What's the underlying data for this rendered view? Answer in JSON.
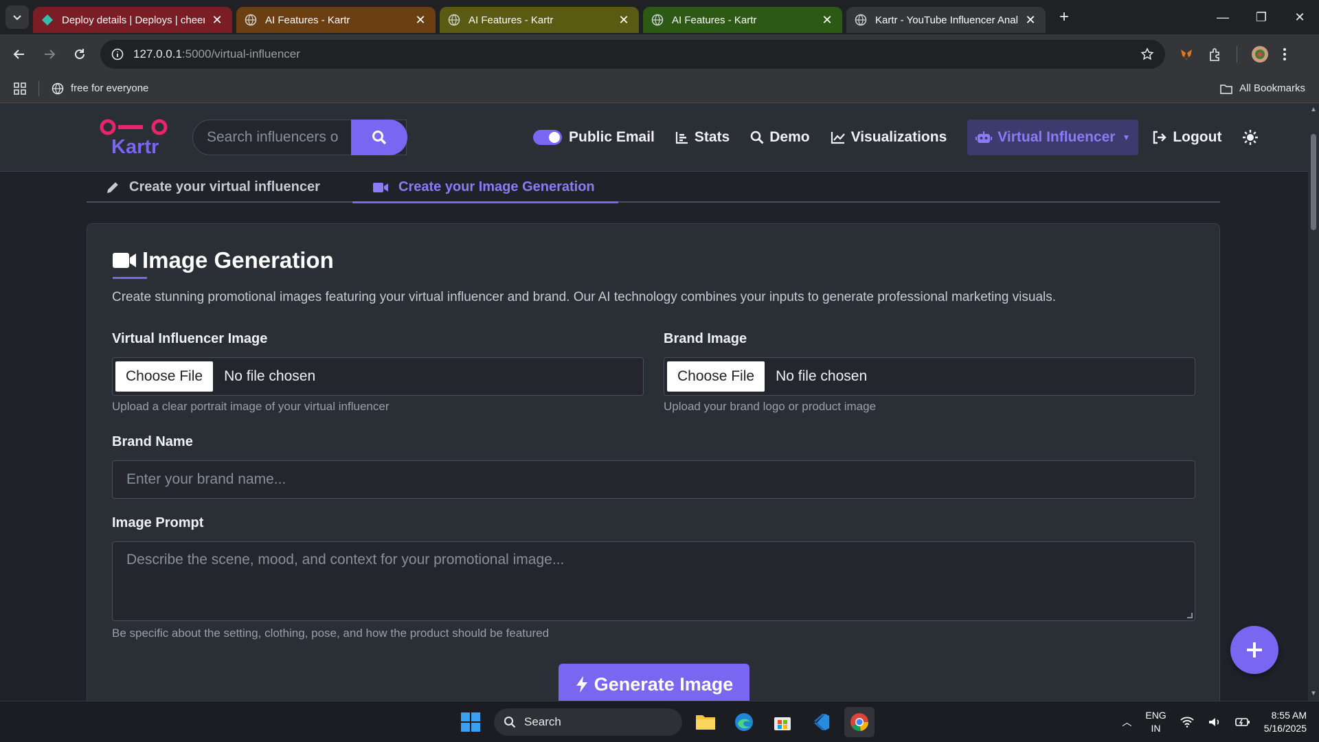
{
  "browser": {
    "tabs": [
      {
        "title": "Deploy details | Deploys | cheer",
        "color": "#7a1d24"
      },
      {
        "title": "AI Features - Kartr",
        "color": "#6b3f12"
      },
      {
        "title": "AI Features - Kartr",
        "color": "#5a5a12"
      },
      {
        "title": "AI Features - Kartr",
        "color": "#2c5a14"
      },
      {
        "title": "Kartr - YouTube Influencer Anal",
        "color": "#35363a"
      }
    ],
    "url_host": "127.0.0.1",
    "url_path": ":5000/virtual-influencer",
    "bookmark": "free for everyone",
    "all_bookmarks": "All Bookmarks"
  },
  "navbar": {
    "logo_text": "Kartr",
    "search_placeholder": "Search influencers o",
    "links": {
      "public_email": "Public Email",
      "stats": "Stats",
      "demo": "Demo",
      "visualizations": "Visualizations",
      "virtual_influencer": "Virtual Influencer",
      "logout": "Logout"
    }
  },
  "page_tabs": {
    "create_influencer": "Create your virtual influencer",
    "create_image": "Create your Image Generation"
  },
  "card": {
    "title": "Image Generation",
    "description": "Create stunning promotional images featuring your virtual influencer and brand. Our AI technology combines your inputs to generate professional marketing visuals.",
    "vi_image_label": "Virtual Influencer Image",
    "vi_image_hint": "Upload a clear portrait image of your virtual influencer",
    "brand_image_label": "Brand Image",
    "brand_image_hint": "Upload your brand logo or product image",
    "choose_file": "Choose File",
    "no_file": "No file chosen",
    "brand_name_label": "Brand Name",
    "brand_name_placeholder": "Enter your brand name...",
    "prompt_label": "Image Prompt",
    "prompt_placeholder": "Describe the scene, mood, and context for your promotional image...",
    "prompt_hint": "Be specific about the setting, clothing, pose, and how the product should be featured",
    "generate_button": "Generate Image"
  },
  "taskbar": {
    "search": "Search",
    "lang_1": "ENG",
    "lang_2": "IN",
    "time": "8:55 AM",
    "date": "5/16/2025"
  },
  "colors": {
    "accent": "#7a66f0",
    "logo_pink": "#e8246a"
  }
}
